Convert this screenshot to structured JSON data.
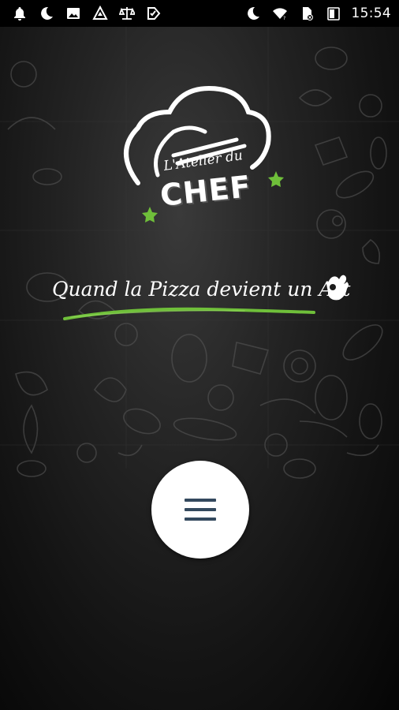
{
  "status_bar": {
    "time": "15:54",
    "left_icons": [
      "notification-bell-icon",
      "do-not-disturb-moon-icon",
      "gallery-image-icon",
      "app-triangle-icon",
      "app-scales-icon",
      "app-check-icon"
    ],
    "right_icons": [
      "do-not-disturb-moon-icon",
      "wifi-icon",
      "sim-card-icon",
      "battery-icon"
    ]
  },
  "logo": {
    "script_text": "L'Atelier du",
    "main_text": "CHEF"
  },
  "tagline": {
    "text": "Quand la Pizza devient un Art"
  },
  "menu_button": {
    "icon": "hamburger-menu-icon"
  },
  "colors": {
    "accent_green": "#6fbf3a",
    "background": "#1c1c1c",
    "button_bg": "#ffffff",
    "menu_icon": "#34495e"
  }
}
